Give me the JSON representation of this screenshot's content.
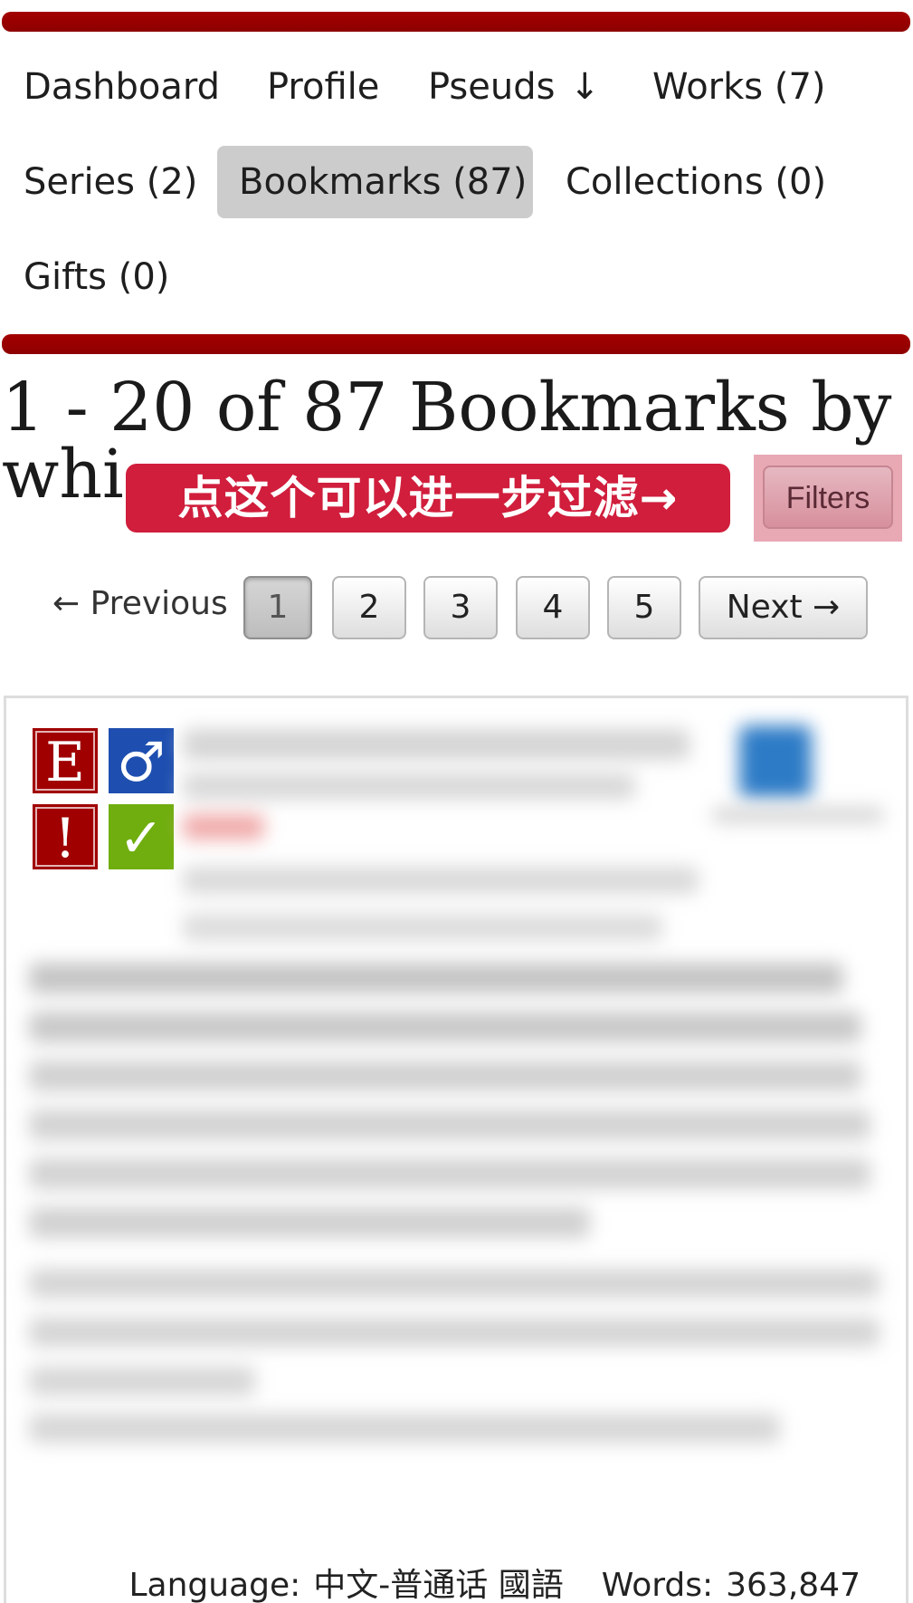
{
  "nav": {
    "dashboard": "Dashboard",
    "profile": "Profile",
    "pseuds": "Pseuds",
    "pseuds_arrow": "↓",
    "works": "Works (7)",
    "series": "Series (2)",
    "bookmarks": "Bookmarks (87)",
    "collections": "Collections (0)",
    "gifts": "Gifts (0)"
  },
  "heading": {
    "line1": "1 - 20 of 87 Bookmarks by",
    "line2": "whi"
  },
  "annotation": "点这个可以进一步过滤→",
  "filters_label": "Filters",
  "pagination": {
    "previous": "← Previous",
    "pages": [
      "1",
      "2",
      "3",
      "4",
      "5"
    ],
    "current": "1",
    "next": "Next →"
  },
  "required_tags": {
    "rating": "E",
    "category": "♂",
    "warning": "!",
    "complete": "✓"
  },
  "stats": {
    "language_label": "Language:",
    "language_value": "中文-普通话 國語",
    "words_label": "Words:",
    "words_value": "363,847"
  },
  "colors": {
    "nav_stripe": "#990000",
    "current_tab_bg": "#cccccc",
    "annotation_bg": "#d01e3c",
    "rating_explicit": "#a00000",
    "category_mm": "#1e4fb0",
    "complete_green": "#6fae0e"
  }
}
